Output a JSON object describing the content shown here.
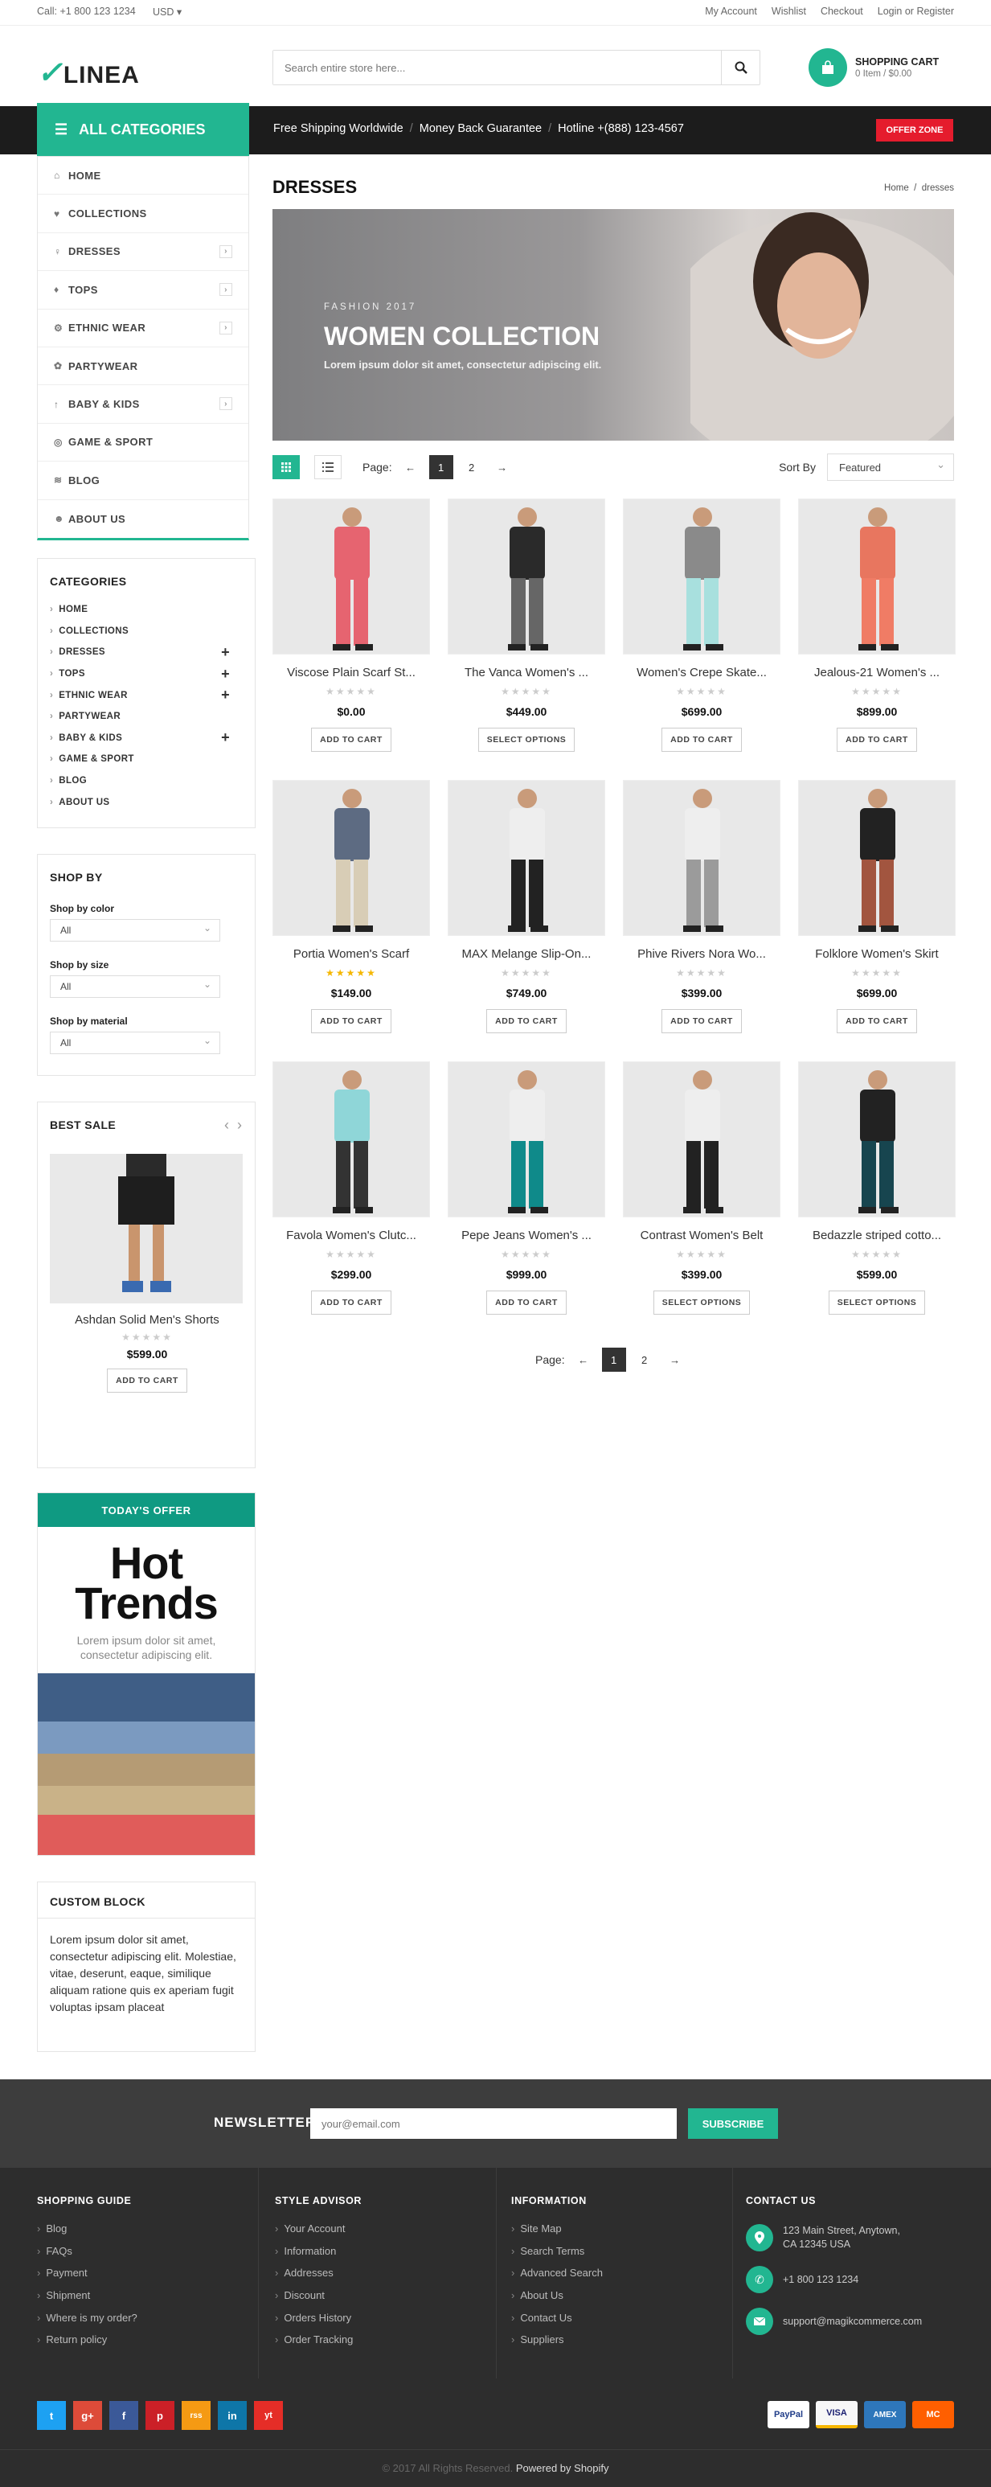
{
  "topbar": {
    "call": "Call: +1 800 123 1234",
    "currency": "USD",
    "links": [
      "My Account",
      "Wishlist",
      "Checkout",
      "Login",
      "or",
      "Register"
    ]
  },
  "header": {
    "logo": "LINEA",
    "search_placeholder": "Search entire store here...",
    "cart_title": "SHOPPING CART",
    "cart_summary": "0 Item / $0.00"
  },
  "nav": {
    "all_categories": "ALL CATEGORIES",
    "shipping": "Free Shipping Worldwide",
    "money_back": "Money Back Guarantee",
    "hotline": "Hotline +(888) 123-4567",
    "offer_zone": "OFFER ZONE"
  },
  "side_menu": [
    "HOME",
    "COLLECTIONS",
    "DRESSES",
    "TOPS",
    "ETHNIC WEAR",
    "PARTYWEAR",
    "BABY & KIDS",
    "GAME & SPORT",
    "BLOG",
    "ABOUT US"
  ],
  "categories": {
    "title": "CATEGORIES",
    "items": [
      "HOME",
      "COLLECTIONS",
      "DRESSES",
      "TOPS",
      "ETHNIC WEAR",
      "PARTYWEAR",
      "BABY & KIDS",
      "GAME & SPORT",
      "BLOG",
      "ABOUT US"
    ]
  },
  "shop_by": {
    "title": "SHOP BY",
    "color_label": "Shop by color",
    "size_label": "Shop by size",
    "material_label": "Shop by material",
    "color_value": "All",
    "size_value": "All",
    "material_value": "All"
  },
  "best_sale": {
    "title": "BEST SALE",
    "name": "Ashdan Solid Men's Shorts",
    "price": "$599.00",
    "button": "ADD TO CART"
  },
  "todays_offer": {
    "title": "TODAY'S OFFER",
    "hot1": "Hot",
    "hot2": "Trends",
    "text": "Lorem ipsum dolor sit amet, consectetur adipiscing elit."
  },
  "custom_block": {
    "title": "CUSTOM BLOCK",
    "text": "Lorem ipsum dolor sit amet, consectetur adipiscing elit. Molestiae, vitae, deserunt, eaque, similique aliquam ratione quis ex aperiam fugit voluptas ipsam placeat"
  },
  "page": {
    "title": "DRESSES",
    "crumb_home": "Home",
    "crumb_current": "dresses"
  },
  "banner": {
    "kicker": "FASHION 2017",
    "headline": "WOMEN COLLECTION",
    "sub": "Lorem ipsum dolor sit amet, consectetur adipiscing elit."
  },
  "toolbar": {
    "page_label": "Page:",
    "pages": [
      "1",
      "2"
    ],
    "sort_label": "Sort By",
    "sort_value": "Featured"
  },
  "products": [
    {
      "name": "Viscose Plain Scarf St...",
      "price": "$0.00",
      "button": "ADD TO CART",
      "rating": 0,
      "top": "#e66470",
      "bottom": "#e66470"
    },
    {
      "name": "The Vanca Women's ...",
      "price": "$449.00",
      "button": "SELECT OPTIONS",
      "rating": 0,
      "top": "#2a2a2a",
      "bottom": "#666"
    },
    {
      "name": "Women's Crepe Skate...",
      "price": "$699.00",
      "button": "ADD TO CART",
      "rating": 0,
      "top": "#8a8a8a",
      "bottom": "#a8e0de"
    },
    {
      "name": "Jealous-21 Women's ...",
      "price": "$899.00",
      "button": "ADD TO CART",
      "rating": 0,
      "top": "#e8765f",
      "bottom": "#f07c65"
    },
    {
      "name": "Portia Women's Scarf",
      "price": "$149.00",
      "button": "ADD TO CART",
      "rating": 5,
      "top": "#5d6b82",
      "bottom": "#d8cdb6"
    },
    {
      "name": "MAX Melange Slip-On...",
      "price": "$749.00",
      "button": "ADD TO CART",
      "rating": 0,
      "top": "#eeeeee",
      "bottom": "#222"
    },
    {
      "name": "Phive Rivers Nora Wo...",
      "price": "$399.00",
      "button": "ADD TO CART",
      "rating": 0,
      "top": "#eeeeee",
      "bottom": "#9b9b9b"
    },
    {
      "name": "Folklore Women's Skirt",
      "price": "$699.00",
      "button": "ADD TO CART",
      "rating": 0,
      "top": "#222",
      "bottom": "#a2553f"
    },
    {
      "name": "Favola Women's Clutc...",
      "price": "$299.00",
      "button": "ADD TO CART",
      "rating": 0,
      "top": "#8fd6d8",
      "bottom": "#333"
    },
    {
      "name": "Pepe Jeans Women's ...",
      "price": "$999.00",
      "button": "ADD TO CART",
      "rating": 0,
      "top": "#eeeeee",
      "bottom": "#0f8a8a"
    },
    {
      "name": "Contrast Women's Belt",
      "price": "$399.00",
      "button": "SELECT OPTIONS",
      "rating": 0,
      "top": "#eeeeee",
      "bottom": "#222"
    },
    {
      "name": "Bedazzle striped cotto...",
      "price": "$599.00",
      "button": "SELECT OPTIONS",
      "rating": 0,
      "top": "#222",
      "bottom": "#17454f"
    }
  ],
  "newsletter": {
    "label": "NEWSLETTER",
    "placeholder": "your@email.com",
    "button": "SUBSCRIBE"
  },
  "footer": {
    "shopping_guide": {
      "title": "SHOPPING GUIDE",
      "links": [
        "Blog",
        "FAQs",
        "Payment",
        "Shipment",
        "Where is my order?",
        "Return policy"
      ]
    },
    "style_advisor": {
      "title": "STYLE ADVISOR",
      "links": [
        "Your Account",
        "Information",
        "Addresses",
        "Discount",
        "Orders History",
        "Order Tracking"
      ]
    },
    "information": {
      "title": "INFORMATION",
      "links": [
        "Site Map",
        "Search Terms",
        "Advanced Search",
        "About Us",
        "Contact Us",
        "Suppliers"
      ]
    },
    "contact": {
      "title": "CONTACT US",
      "address1": "123 Main Street, Anytown,",
      "address2": "CA 12345 USA",
      "phone": "+1 800 123 1234",
      "email": "support@magikcommerce.com"
    },
    "social": [
      "t",
      "g+",
      "f",
      "p",
      "rss",
      "in",
      "yt"
    ],
    "payments": [
      "PayPal",
      "VISA",
      "AMEX",
      "MC"
    ],
    "copyright": "© 2017 All Rights Reserved.",
    "powered": "Powered by Shopify"
  },
  "colors": {
    "accent": "#22b691",
    "dark": "#1c1c1c",
    "offer": "#e51c2d"
  }
}
